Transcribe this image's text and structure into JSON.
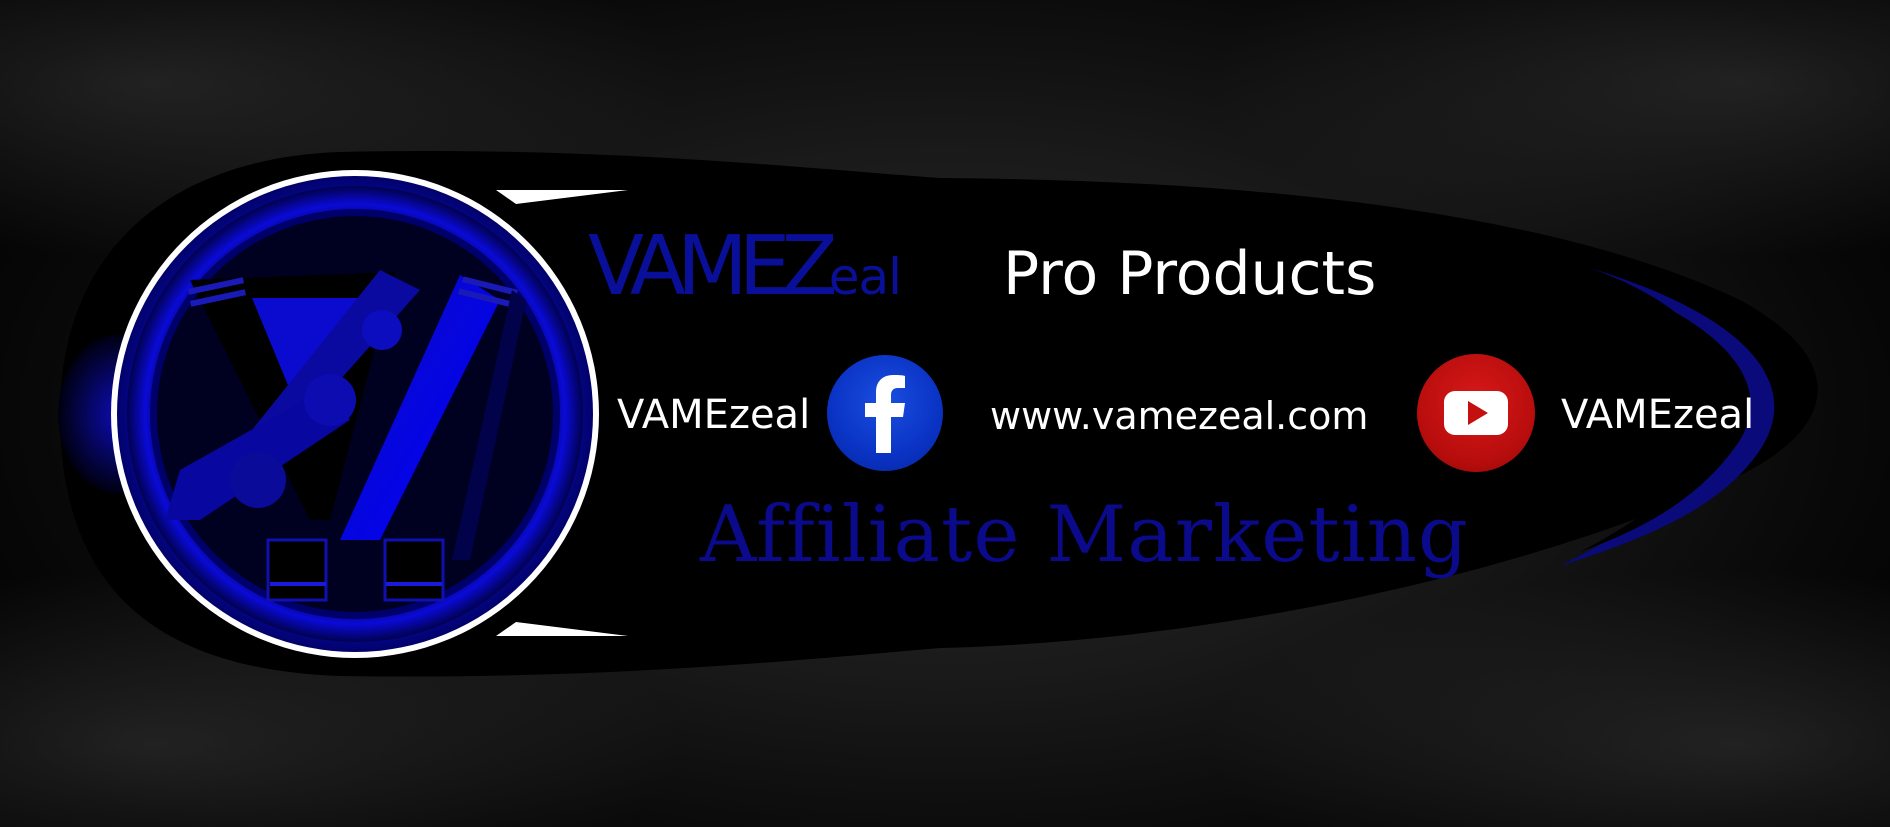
{
  "banner": {
    "wordmark_main": "VAMEZ",
    "wordmark_tail": "eal",
    "headline": "Pro Products",
    "facebook_handle": "VAMEzeal",
    "website": "www.vamezeal.com",
    "youtube_handle": "VAMEzeal",
    "tagline": "Affiliate Marketing"
  },
  "icons": {
    "logo": "vamezeal-emblem",
    "facebook": "facebook-icon",
    "youtube": "youtube-icon"
  },
  "colors": {
    "background": "#000000",
    "accent_blue": "#0a0fa0",
    "facebook_blue": "#0a33c4",
    "youtube_red": "#c4100f",
    "text": "#ffffff"
  }
}
